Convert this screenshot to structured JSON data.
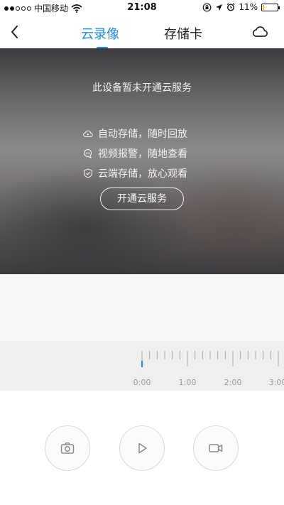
{
  "status_bar": {
    "carrier": "中国移动",
    "time": "21:08",
    "battery": "11%",
    "battery_level": 0.11,
    "battery_color": "#f5c400"
  },
  "nav": {
    "tabs": [
      {
        "label": "云录像",
        "active": true
      },
      {
        "label": "存储卡",
        "active": false
      }
    ],
    "accent_color": "#1a8cf0",
    "icons": [
      "back-chevron-icon",
      "cloud-icon"
    ]
  },
  "video": {
    "title": "此设备暂未开通云服务",
    "features": [
      {
        "icon": "cloud-play-icon",
        "text": "自动存储，随时回放"
      },
      {
        "icon": "chat-icon",
        "text": "视频报警，随地查看"
      },
      {
        "icon": "shield-check-icon",
        "text": "云端存储，放心观看"
      }
    ],
    "button_label": "开通云服务"
  },
  "timeline": {
    "labels": [
      "0:00",
      "1:00",
      "2:00",
      "3:00"
    ]
  },
  "controls": {
    "icons": [
      "camera-icon",
      "play-icon",
      "video-camera-icon"
    ]
  }
}
